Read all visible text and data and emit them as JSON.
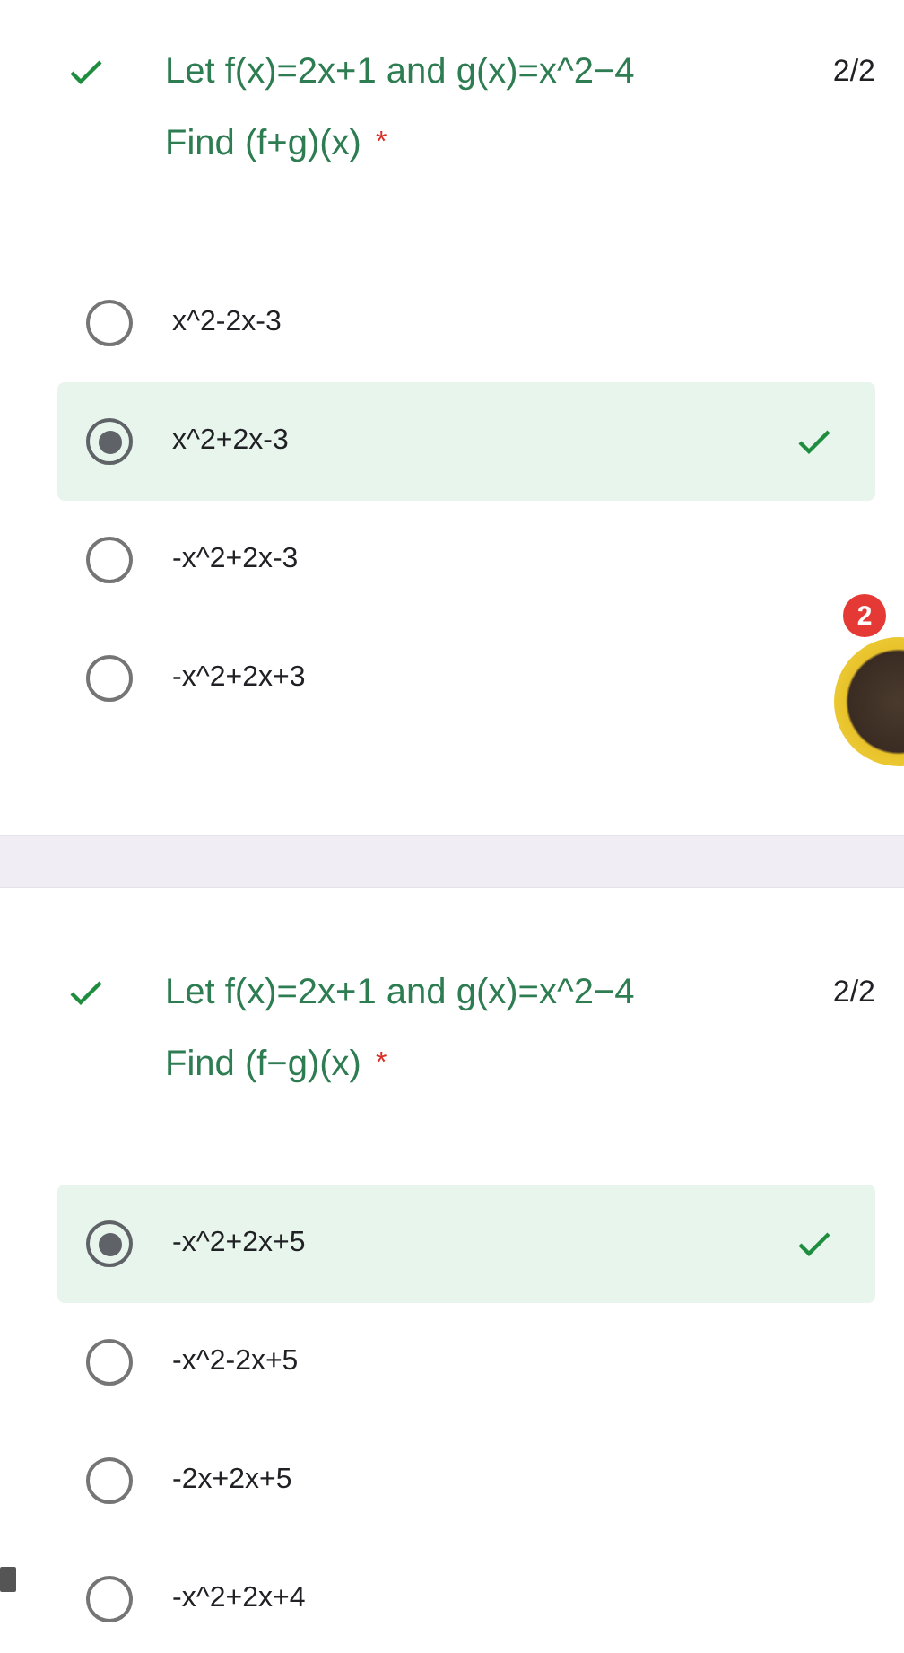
{
  "questions": [
    {
      "correct": true,
      "title": "Let f(x)=2x+1 and g(x)=x^2−4",
      "subtitle": "Find (f+g)(x)",
      "required_mark": "*",
      "score": "2/2",
      "options": [
        {
          "label": "x^2-2x-3",
          "selected": false,
          "correct": false
        },
        {
          "label": "x^2+2x-3",
          "selected": true,
          "correct": true
        },
        {
          "label": "-x^2+2x-3",
          "selected": false,
          "correct": false
        },
        {
          "label": "-x^2+2x+3",
          "selected": false,
          "correct": false
        }
      ]
    },
    {
      "correct": true,
      "title": "Let f(x)=2x+1 and g(x)=x^2−4",
      "subtitle": "Find (f−g)(x)",
      "required_mark": "*",
      "score": "2/2",
      "options": [
        {
          "label": "-x^2+2x+5",
          "selected": true,
          "correct": true
        },
        {
          "label": "-x^2-2x+5",
          "selected": false,
          "correct": false
        },
        {
          "label": "-2x+2x+5",
          "selected": false,
          "correct": false
        },
        {
          "label": "-x^2+2x+4",
          "selected": false,
          "correct": false
        }
      ]
    }
  ],
  "chat_head": {
    "badge": "2"
  }
}
